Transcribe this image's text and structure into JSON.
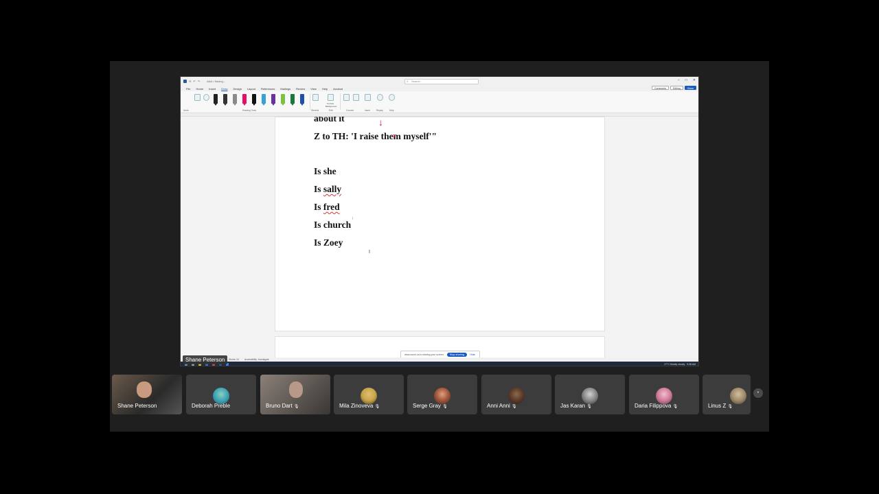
{
  "window": {
    "title": "AAA • Saving...",
    "search_placeholder": "Search",
    "controls": [
      "–",
      "□",
      "✕"
    ]
  },
  "menubar": {
    "items": [
      "File",
      "Home",
      "Insert",
      "Draw",
      "Design",
      "Layout",
      "References",
      "Mailings",
      "Review",
      "View",
      "Help",
      "Acrobat"
    ],
    "active": "Draw",
    "comments_label": "Comments",
    "editing_label": "Editing",
    "share_label": "Share"
  },
  "ribbon": {
    "group_undo": "Undo",
    "group_drawing_tools": "Drawing Tools",
    "group_stencils": "Stencils",
    "group_edit": "Edit",
    "group_convert": "Convert",
    "group_insert": "Insert",
    "group_replay": "Replay",
    "group_help": "Help",
    "tool_ruler": "Ruler",
    "tool_format_bg": "Format Background",
    "tool_ink_to_shape": "Ink to Shape",
    "tool_ink_to_math": "Ink to Math",
    "tool_drawing_canvas": "Drawing Canvas",
    "tool_ink_replay": "Ink Replay",
    "tool_ink_help": "Ink Help",
    "pen_colors": [
      "#222222",
      "#333333",
      "#8a8a8a",
      "#e0106b",
      "#111111",
      "#3aa0d8",
      "#6b2fa0",
      "#7cc242",
      "#1a7a3a",
      "#1f4fa8"
    ]
  },
  "document": {
    "line1": "about it",
    "line2": "Z to TH: 'I raise them myself'\"",
    "line3": "Is she",
    "line4_prefix": "Is ",
    "line4_word": "sally",
    "line5_prefix": "Is ",
    "line5_word": "fred",
    "line6": "Is church",
    "line7": "Is Zoey",
    "ink_color": "#e0106b"
  },
  "share_banner": {
    "text": "www.zoom.us is sharing your screen.",
    "stop_label": "Stop sharing",
    "hide_label": "Hide"
  },
  "statusbar": {
    "words": "Words: 24",
    "accessibility": "Accessibility: Investigate"
  },
  "taskbar": {
    "weather": "27°C Mostly cloudy",
    "time": "9:38 AM"
  },
  "presenter": "Shane Peterson",
  "participants": [
    {
      "name": "Shane Peterson",
      "type": "camera"
    },
    {
      "name": "Deborah Preble",
      "type": "avatar",
      "color": "#3a9fb0"
    },
    {
      "name": "Bruno Dart",
      "type": "camera",
      "muted": true
    },
    {
      "name": "Mila Zinoveva",
      "type": "avatar",
      "color": "#c9a44a",
      "muted": true
    },
    {
      "name": "Serge Gray",
      "type": "avatar",
      "color": "#a0543a",
      "muted": true
    },
    {
      "name": "Anni Anni",
      "type": "avatar",
      "color": "#5a3a2a",
      "muted": true
    },
    {
      "name": "Jas Karan",
      "type": "avatar",
      "color": "#888888",
      "muted": true
    },
    {
      "name": "Daria Filippova",
      "type": "avatar",
      "color": "#d07a9a",
      "muted": true
    },
    {
      "name": "Linus Z",
      "type": "avatar",
      "color": "#a08a6a",
      "muted": true
    }
  ],
  "mic_muted_glyph": "🎙"
}
